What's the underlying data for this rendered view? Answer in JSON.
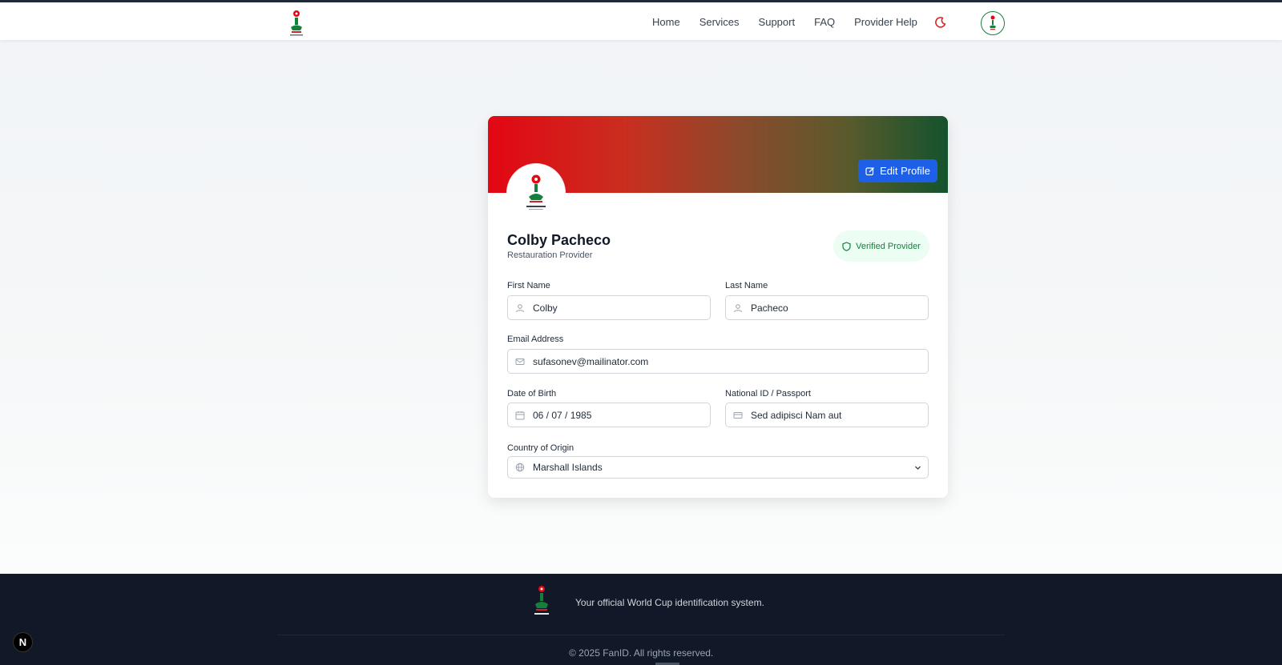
{
  "nav": {
    "items": [
      "Home",
      "Services",
      "Support",
      "FAQ",
      "Provider Help"
    ]
  },
  "icons": {
    "brand": "mascot-logo-icon",
    "theme": "moon-icon",
    "avatar": "user-avatar-icon",
    "edit": "edit-icon",
    "shield": "shield-icon",
    "user": "user-icon",
    "mail": "mail-icon",
    "calendar": "calendar-icon",
    "id": "id-card-icon",
    "globe": "globe-icon",
    "chevron": "chevron-down-icon"
  },
  "colors": {
    "primary_button": "#1d5fe6",
    "verified_text": "#15803d",
    "banner_start": "#e30613",
    "banner_end": "#14532d",
    "footer_bg": "#111827",
    "moon": "#dc2626"
  },
  "profile": {
    "edit_label": "Edit Profile",
    "name": "Colby Pacheco",
    "role": "Restauration Provider",
    "badge": "Verified Provider"
  },
  "form": {
    "first_name": {
      "label": "First Name",
      "value": "Colby"
    },
    "last_name": {
      "label": "Last Name",
      "value": "Pacheco"
    },
    "email": {
      "label": "Email Address",
      "value": "sufasonev@mailinator.com"
    },
    "dob": {
      "label": "Date of Birth",
      "value": "06 / 07 / 1985"
    },
    "national_id": {
      "label": "National ID / Passport",
      "value": "Sed adipisci Nam aut"
    },
    "country": {
      "label": "Country of Origin",
      "value": "Marshall Islands"
    }
  },
  "footer": {
    "tagline": "Your official World Cup identification system.",
    "copyright": "© 2025 FanID. All rights reserved."
  },
  "dev_badge": "N"
}
